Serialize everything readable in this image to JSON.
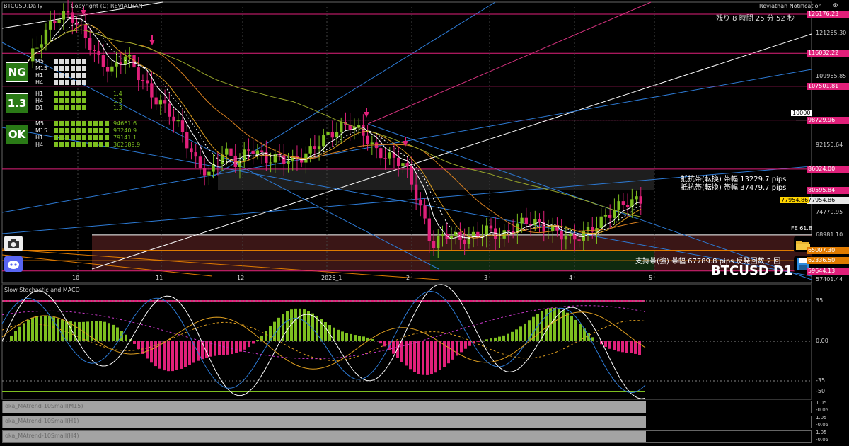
{
  "header": {
    "symbol": "BTCUSD,Daily",
    "copyright": "Copyright (C) REVIATHAN",
    "notification": "Reviathan Notification",
    "countdown": "残り 8 時間 25 分 52 秒",
    "watermark": "BTCUSD D1"
  },
  "badges": {
    "ng": "NG",
    "ratio": "1.3",
    "ok": "OK"
  },
  "tf_panel": {
    "ng_rows": [
      "M5",
      "M15",
      "H1",
      "H4"
    ],
    "ratio_rows": [
      {
        "tf": "H1",
        "val": "1.4"
      },
      {
        "tf": "H4",
        "val": "1.3"
      },
      {
        "tf": "D1",
        "val": "1.3"
      }
    ],
    "ok_rows": [
      {
        "tf": "M5",
        "val": "94661.6"
      },
      {
        "tf": "M15",
        "val": "93240.9"
      },
      {
        "tf": "H1",
        "val": "79141.1"
      },
      {
        "tf": "H4",
        "val": "362589.9"
      }
    ]
  },
  "annotations": {
    "resist_1": "抵抗帯(転換) 帯幅 13229.7 pips",
    "resist_2": "抵抗帯(転換) 帯幅 37479.7 pips",
    "support": "支持帯(強) 帯幅 67789.8 pips 反発回数 2 回",
    "fe": "FE 61.8",
    "level_10000": "10000"
  },
  "price_axis": [
    "121265.30",
    "109965.85",
    "92150.64",
    "74770.95",
    "68981.10",
    "57401.44"
  ],
  "price_tags": [
    {
      "label": "126176.23",
      "color": "#e0207a"
    },
    {
      "label": "116032.22",
      "color": "#e0207a"
    },
    {
      "label": "107501.81",
      "color": "#e0207a"
    },
    {
      "label": "98729.96",
      "color": "#e0207a"
    },
    {
      "label": "86024.00",
      "color": "#e0207a"
    },
    {
      "label": "80595.84",
      "color": "#e0207a"
    },
    {
      "label": "77954.86",
      "color": "#e8e8e8"
    },
    {
      "label": "65007.30",
      "color": "#e07b00"
    },
    {
      "label": "62336.50",
      "color": "#e07b00"
    },
    {
      "label": "59644.13",
      "color": "#e0207a"
    }
  ],
  "current_price": "77954.86",
  "indicator": {
    "title": "Slow Stochastic and MACD",
    "levels": [
      "35",
      "0.00",
      "-35",
      "-50"
    ]
  },
  "ma_trend_panels": [
    {
      "title": "oka_MAtrend-10Small(M15)",
      "top": "1.05",
      "bottom": "-0.05"
    },
    {
      "title": "oka_MAtrend-10Small(H1)",
      "top": "1.05",
      "bottom": "-0.05"
    },
    {
      "title": "oka_MAtrend-10Small(H4)",
      "top": "1.05",
      "bottom": "-0.05"
    }
  ],
  "time_axis": [
    "10",
    "11",
    "12",
    "2026_1",
    "2",
    "3",
    "4",
    "5"
  ],
  "chart_data": {
    "type": "candlestick",
    "symbol": "BTCUSD",
    "timeframe": "Daily",
    "ylim": [
      57401.44,
      128000
    ],
    "x_ticks": [
      "10",
      "11",
      "12",
      "2026_1",
      "2",
      "3",
      "4",
      "5"
    ],
    "close_path": [
      114000,
      120000,
      125500,
      126176,
      121000,
      114500,
      111500,
      115800,
      110000,
      104500,
      101500,
      96000,
      88000,
      84500,
      91000,
      87500,
      91800,
      88500,
      89000,
      88000,
      89800,
      93500,
      95800,
      97800,
      95500,
      90500,
      89000,
      87500,
      78000,
      66000,
      69500,
      67800,
      68500,
      70500,
      68200,
      71500,
      72800,
      71000,
      69800,
      67800,
      69500,
      72000,
      75500,
      77500,
      77954.86
    ],
    "resistance_levels": [
      126176.23,
      116032.22,
      107501.81,
      98729.96,
      86024.0,
      80595.84
    ],
    "support_levels": [
      65007.3,
      62336.5,
      59644.13
    ],
    "current": 77954.86
  }
}
